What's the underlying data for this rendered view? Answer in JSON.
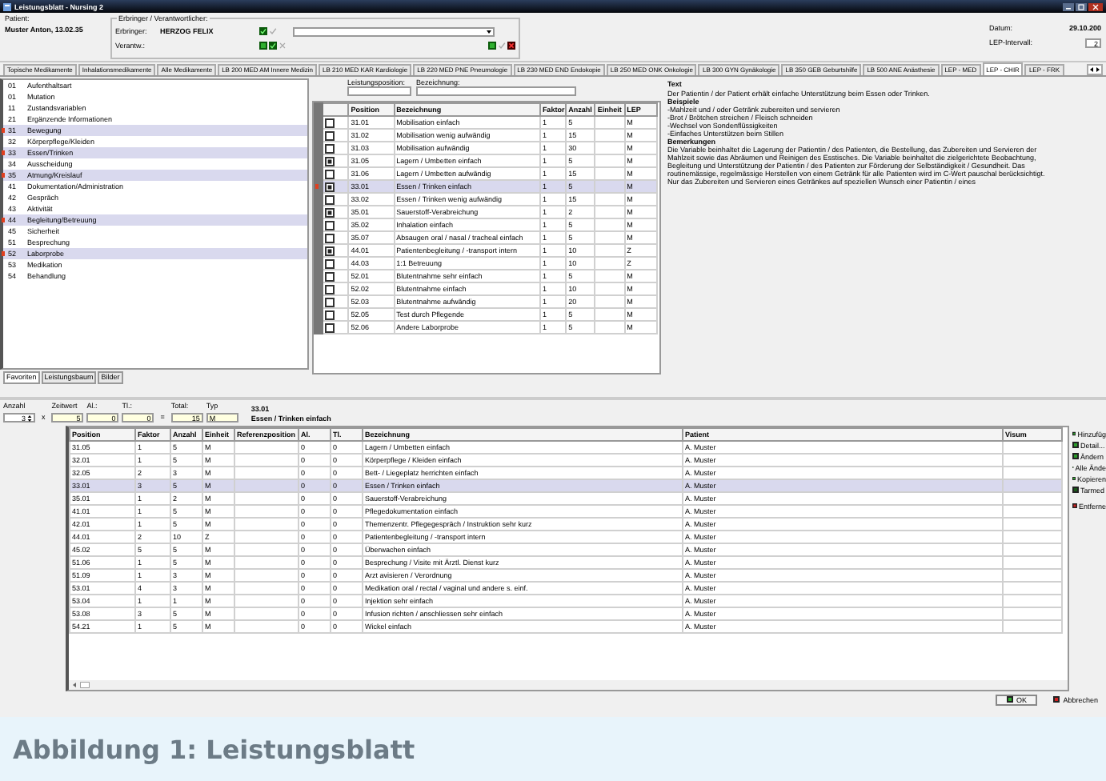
{
  "window": {
    "title": "Leistungsblatt - Nursing 2"
  },
  "header": {
    "patient_label": "Patient:",
    "patient": "Muster Anton, 13.02.35",
    "group_label": "Erbringer / Verantwortlicher:",
    "erbringer_label": "Erbringer:",
    "erbringer": "HERZOG FELIX",
    "verantw_label": "Verantw.:",
    "date_label": "Datum:",
    "date": "29.10.200",
    "interval_label": "LEP-Intervall:",
    "interval": "2"
  },
  "tabs": [
    {
      "label": "Topische Medikamente",
      "selected": false
    },
    {
      "label": "Inhalationsmedikamente",
      "selected": false
    },
    {
      "label": "Alle Medikamente",
      "selected": false
    },
    {
      "label": "LB 200 MED AM Innere Medizin",
      "selected": false
    },
    {
      "label": "LB 210 MED KAR Kardiologie",
      "selected": false
    },
    {
      "label": "LB 220 MED PNE Pneumologie",
      "selected": false
    },
    {
      "label": "LB 230 MED END Endokopie",
      "selected": false
    },
    {
      "label": "LB 250 MED ONK Onkologie",
      "selected": false
    },
    {
      "label": "LB 300 GYN Gynäkologie",
      "selected": false
    },
    {
      "label": "LB 350 GEB Geburtshilfe",
      "selected": false
    },
    {
      "label": "LB 500 ANE Anästhesie",
      "selected": false
    },
    {
      "label": "LEP - MED",
      "selected": false
    },
    {
      "label": "LEP - CHIR",
      "selected": true
    },
    {
      "label": "LEP - FRK",
      "selected": false
    }
  ],
  "categories": [
    {
      "code": "01",
      "label": "Aufenthaltsart",
      "highlighted": false
    },
    {
      "code": "01",
      "label": "Mutation",
      "highlighted": false
    },
    {
      "code": "11",
      "label": "Zustandsvariablen",
      "highlighted": false
    },
    {
      "code": "21",
      "label": "Ergänzende Informationen",
      "highlighted": false
    },
    {
      "code": "31",
      "label": "Bewegung",
      "highlighted": true
    },
    {
      "code": "32",
      "label": "Körperpflege/Kleiden",
      "highlighted": false
    },
    {
      "code": "33",
      "label": "Essen/Trinken",
      "highlighted": true
    },
    {
      "code": "34",
      "label": "Ausscheidung",
      "highlighted": false
    },
    {
      "code": "35",
      "label": "Atmung/Kreislauf",
      "highlighted": true
    },
    {
      "code": "41",
      "label": "Dokumentation/Administration",
      "highlighted": false
    },
    {
      "code": "42",
      "label": "Gespräch",
      "highlighted": false
    },
    {
      "code": "43",
      "label": "Aktivität",
      "highlighted": false
    },
    {
      "code": "44",
      "label": "Begleitung/Betreuung",
      "highlighted": true
    },
    {
      "code": "45",
      "label": "Sicherheit",
      "highlighted": false
    },
    {
      "code": "51",
      "label": "Besprechung",
      "highlighted": false
    },
    {
      "code": "52",
      "label": "Laborprobe",
      "highlighted": true
    },
    {
      "code": "53",
      "label": "Medikation",
      "highlighted": false
    },
    {
      "code": "54",
      "label": "Behandlung",
      "highlighted": false
    }
  ],
  "list_tabs": [
    {
      "label": "Favoriten",
      "selected": true
    },
    {
      "label": "Leistungsbaum",
      "selected": false
    },
    {
      "label": "Bilder",
      "selected": false
    }
  ],
  "positions": {
    "field_labels": [
      "Leistungsposition:",
      "Bezeichnung:"
    ],
    "columns": [
      "Position",
      "Bezeichnung",
      "Faktor",
      "Anzahl",
      "Einheit",
      "LEP"
    ],
    "rows": [
      {
        "checked": false,
        "selected": false,
        "cells": [
          "31.01",
          "Mobilisation einfach",
          "1",
          "5",
          "",
          "M"
        ]
      },
      {
        "checked": false,
        "selected": false,
        "cells": [
          "31.02",
          "Mobilisation wenig aufwändig",
          "1",
          "15",
          "",
          "M"
        ]
      },
      {
        "checked": false,
        "selected": false,
        "cells": [
          "31.03",
          "Mobilisation aufwändig",
          "1",
          "30",
          "",
          "M"
        ]
      },
      {
        "checked": true,
        "selected": false,
        "cells": [
          "31.05",
          "Lagern / Umbetten einfach",
          "1",
          "5",
          "",
          "M"
        ]
      },
      {
        "checked": false,
        "selected": false,
        "cells": [
          "31.06",
          "Lagern / Umbetten aufwändig",
          "1",
          "15",
          "",
          "M"
        ]
      },
      {
        "checked": true,
        "selected": true,
        "cells": [
          "33.01",
          "Essen / Trinken einfach",
          "1",
          "5",
          "",
          "M"
        ]
      },
      {
        "checked": false,
        "selected": false,
        "cells": [
          "33.02",
          "Essen / Trinken wenig aufwändig",
          "1",
          "15",
          "",
          "M"
        ]
      },
      {
        "checked": true,
        "selected": false,
        "cells": [
          "35.01",
          "Sauerstoff-Verabreichung",
          "1",
          "2",
          "",
          "M"
        ]
      },
      {
        "checked": false,
        "selected": false,
        "cells": [
          "35.02",
          "Inhalation einfach",
          "1",
          "5",
          "",
          "M"
        ]
      },
      {
        "checked": false,
        "selected": false,
        "cells": [
          "35.07",
          "Absaugen oral / nasal / tracheal einfach",
          "1",
          "5",
          "",
          "M"
        ]
      },
      {
        "checked": true,
        "selected": false,
        "cells": [
          "44.01",
          "Patientenbegleitung / -transport intern",
          "1",
          "10",
          "",
          "Z"
        ]
      },
      {
        "checked": false,
        "selected": false,
        "cells": [
          "44.03",
          "1:1 Betreuung",
          "1",
          "10",
          "",
          "Z"
        ]
      },
      {
        "checked": false,
        "selected": false,
        "cells": [
          "52.01",
          "Blutentnahme sehr einfach",
          "1",
          "5",
          "",
          "M"
        ]
      },
      {
        "checked": false,
        "selected": false,
        "cells": [
          "52.02",
          "Blutentnahme einfach",
          "1",
          "10",
          "",
          "M"
        ]
      },
      {
        "checked": false,
        "selected": false,
        "cells": [
          "52.03",
          "Blutentnahme aufwändig",
          "1",
          "20",
          "",
          "M"
        ]
      },
      {
        "checked": false,
        "selected": false,
        "cells": [
          "52.05",
          "Test durch Pflegende",
          "1",
          "5",
          "",
          "M"
        ]
      },
      {
        "checked": false,
        "selected": false,
        "cells": [
          "52.06",
          "Andere Laborprobe",
          "1",
          "5",
          "",
          "M"
        ]
      }
    ]
  },
  "text_panel": {
    "title": "Text",
    "paragraphs": [
      {
        "kind": "text",
        "text": "Der Patientin / der Patient erhält einfache Unterstützung beim Essen oder Trinken."
      },
      {
        "kind": "heading",
        "text": "Beispiele"
      },
      {
        "kind": "text",
        "text": "-Mahlzeit und / oder Getränk zubereiten und servieren"
      },
      {
        "kind": "text",
        "text": "-Brot / Brötchen streichen / Fleisch schneiden"
      },
      {
        "kind": "text",
        "text": "-Wechsel von Sondenflüssigkeiten"
      },
      {
        "kind": "text",
        "text": "-Einfaches Unterstützen beim Stillen"
      },
      {
        "kind": "heading",
        "text": "Bemerkungen"
      },
      {
        "kind": "text",
        "text": "Die Variable beinhaltet die Lagerung der Patientin / des Patienten, die Bestellung, das Zubereiten und Servieren der Mahlzeit sowie das Abräumen und Reinigen des Esstisches. Die Variable beinhaltet die zielgerichtete Beobachtung, Begleitung und Unterstützung der Patientin / des Patienten zur Förderung der Selbständigkeit / Gesundheit. Das routinemässige, regelmässige Herstellen von einem Getränk für alle Patienten wird im C-Wert pauschal berücksichtigt. Nur das Zubereiten und Servieren eines Getränkes auf speziellen Wunsch einer Patientin / eines"
      }
    ]
  },
  "entry": {
    "fields": [
      {
        "label": "Anzahl",
        "value": "3",
        "kind": "spin",
        "op": "x"
      },
      {
        "label": "Zeitwert",
        "value": "5",
        "kind": "number"
      },
      {
        "label": "Al.:",
        "value": "0",
        "kind": "number"
      },
      {
        "label": "Tl.:",
        "value": "0",
        "kind": "number",
        "op": "="
      },
      {
        "label": "Total:",
        "value": "15",
        "kind": "number"
      },
      {
        "label": "Typ",
        "value": "M",
        "kind": "text"
      }
    ],
    "code": "33.01",
    "name": "Essen / Trinken einfach"
  },
  "booked": {
    "columns": [
      "Position",
      "Faktor",
      "Anzahl",
      "Einheit",
      "Referenzposition",
      "Al.",
      "Tl.",
      "Bezeichnung",
      "Patient",
      "Visum"
    ],
    "rows": [
      {
        "selected": false,
        "cells": [
          "31.05",
          "1",
          "5",
          "M",
          "",
          "0",
          "0",
          "Lagern / Umbetten einfach",
          "A. Muster",
          ""
        ]
      },
      {
        "selected": false,
        "cells": [
          "32.01",
          "1",
          "5",
          "M",
          "",
          "0",
          "0",
          "Körperpflege / Kleiden einfach",
          "A. Muster",
          ""
        ]
      },
      {
        "selected": false,
        "cells": [
          "32.05",
          "2",
          "3",
          "M",
          "",
          "0",
          "0",
          "Bett- / Liegeplatz herrichten einfach",
          "A. Muster",
          ""
        ]
      },
      {
        "selected": true,
        "cells": [
          "33.01",
          "3",
          "5",
          "M",
          "",
          "0",
          "0",
          "Essen / Trinken einfach",
          "A. Muster",
          ""
        ]
      },
      {
        "selected": false,
        "cells": [
          "35.01",
          "1",
          "2",
          "M",
          "",
          "0",
          "0",
          "Sauerstoff-Verabreichung",
          "A. Muster",
          ""
        ]
      },
      {
        "selected": false,
        "cells": [
          "41.01",
          "1",
          "5",
          "M",
          "",
          "0",
          "0",
          "Pflegedokumentation einfach",
          "A. Muster",
          ""
        ]
      },
      {
        "selected": false,
        "cells": [
          "42.01",
          "1",
          "5",
          "M",
          "",
          "0",
          "0",
          "Themenzentr. Pflegegespräch / Instruktion sehr kurz",
          "A. Muster",
          ""
        ]
      },
      {
        "selected": false,
        "cells": [
          "44.01",
          "2",
          "10",
          "Z",
          "",
          "0",
          "0",
          "Patientenbegleitung / -transport intern",
          "A. Muster",
          ""
        ]
      },
      {
        "selected": false,
        "cells": [
          "45.02",
          "5",
          "5",
          "M",
          "",
          "0",
          "0",
          "Überwachen einfach",
          "A. Muster",
          ""
        ]
      },
      {
        "selected": false,
        "cells": [
          "51.06",
          "1",
          "5",
          "M",
          "",
          "0",
          "0",
          "Besprechung / Visite mit Ärztl. Dienst kurz",
          "A. Muster",
          ""
        ]
      },
      {
        "selected": false,
        "cells": [
          "51.09",
          "1",
          "3",
          "M",
          "",
          "0",
          "0",
          "Arzt avisieren / Verordnung",
          "A. Muster",
          ""
        ]
      },
      {
        "selected": false,
        "cells": [
          "53.01",
          "4",
          "3",
          "M",
          "",
          "0",
          "0",
          "Medikation oral / rectal / vaginal und andere s. einf.",
          "A. Muster",
          ""
        ]
      },
      {
        "selected": false,
        "cells": [
          "53.04",
          "1",
          "1",
          "M",
          "",
          "0",
          "0",
          "Injektion sehr einfach",
          "A. Muster",
          ""
        ]
      },
      {
        "selected": false,
        "cells": [
          "53.08",
          "3",
          "5",
          "M",
          "",
          "0",
          "0",
          "Infusion richten / anschliessen sehr einfach",
          "A. Muster",
          ""
        ]
      },
      {
        "selected": false,
        "cells": [
          "54.21",
          "1",
          "5",
          "M",
          "",
          "0",
          "0",
          "Wickel einfach",
          "A. Muster",
          ""
        ]
      }
    ]
  },
  "side_buttons": [
    {
      "label": "Hinzufüg",
      "kind": "add"
    },
    {
      "label": "Detail...",
      "kind": "detail"
    },
    {
      "label": "Ändern",
      "kind": "edit"
    },
    {
      "label": "Alle Ände",
      "kind": "edit"
    },
    {
      "label": "Kopieren",
      "kind": "copy"
    },
    {
      "label": "Tarmed",
      "kind": "tarmed"
    },
    {
      "label": "Entferne",
      "kind": "remove"
    }
  ],
  "dialog_buttons": [
    {
      "label": "OK",
      "kind": "ok"
    },
    {
      "label": "Abbrechen",
      "kind": "cancel"
    }
  ],
  "caption": "Abbildung 1: Leistungsblatt"
}
